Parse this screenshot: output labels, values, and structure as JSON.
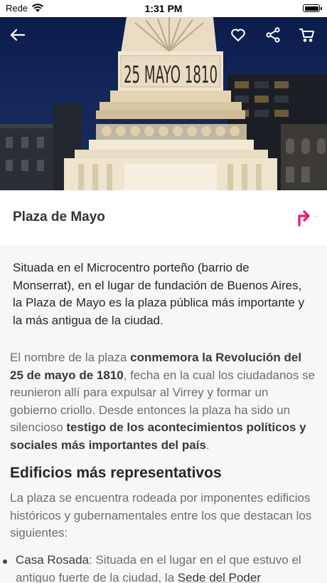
{
  "status": {
    "carrier": "Rede",
    "time": "1:31 PM"
  },
  "hero": {
    "monument_inscription": "25 MAYO 1810",
    "icons": [
      "back-arrow-icon",
      "heart-icon",
      "share-icon",
      "cart-icon"
    ]
  },
  "header": {
    "title": "Plaza de Mayo",
    "directions_icon": "directions-arrow-icon"
  },
  "article": {
    "intro": "Situada en el Microcentro porteño (barrio de Monserrat), en el lugar de fundación de Buenos Aires, la Plaza de Mayo es la plaza pública más importante y la más antigua de la ciudad.",
    "p1": {
      "t1": "El nombre de la plaza ",
      "b1": "conmemora la Revolución del 25 de mayo de 1810",
      "t2": ", fecha en la cual los ciudadanos se reunieron allí para expulsar al Virrey y formar un gobierno criollo. Desde entonces la plaza ha sido un silencioso ",
      "b2": "testigo de los acontecimientos políticos y sociales más importantes del país",
      "t3": "."
    },
    "section_title": "Edificios más representativos",
    "p2": "La plaza se encuentra rodeada por imponentes edificios históricos y gubernamentales entre los que destacan los siguientes:",
    "bullet": {
      "name": "Casa Rosada",
      "text": ": Situada en el lugar en el que estuvo el antiguo fuerte de la ciudad, la ",
      "link": "Sede del Poder"
    }
  },
  "colors": {
    "accent": "#e8237a",
    "sky": "#14275c",
    "text_dark": "#262626",
    "text_muted": "#6e6e6e"
  }
}
